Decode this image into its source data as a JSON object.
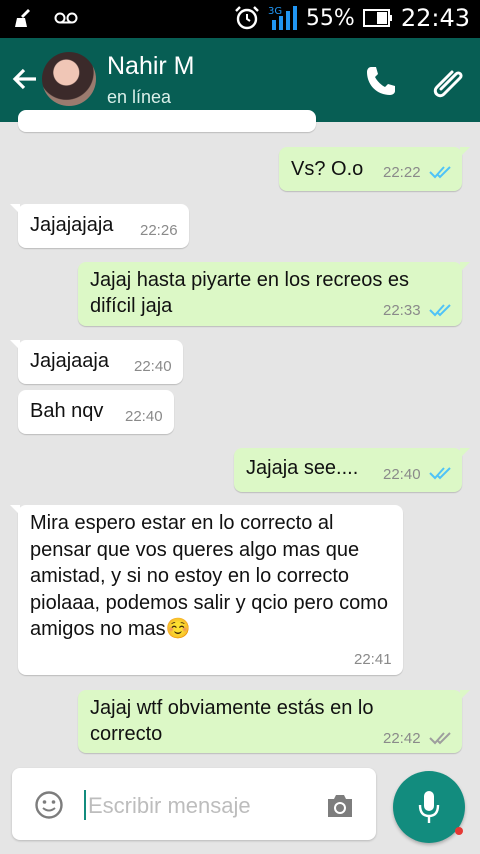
{
  "status_bar": {
    "battery": "55%",
    "time": "22:43",
    "network": "3G"
  },
  "header": {
    "contact_name": "Nahir M",
    "contact_status": "en línea",
    "icons": [
      "back-arrow-icon",
      "phone-icon",
      "paperclip-icon"
    ]
  },
  "messages": [
    {
      "dir": "out",
      "text": "Vs?  O.o",
      "time": "22:22",
      "status": "read"
    },
    {
      "dir": "in",
      "text": "Jajajajaja",
      "time": "22:26"
    },
    {
      "dir": "out",
      "text": "Jajaj hasta piyarte en los recreos es difícil jaja",
      "time": "22:33",
      "status": "read"
    },
    {
      "dir": "in",
      "text": "Jajajaaja",
      "time": "22:40"
    },
    {
      "dir": "in",
      "text": "Bah nqv",
      "time": "22:40"
    },
    {
      "dir": "out",
      "text": "Jajaja see....",
      "time": "22:40",
      "status": "read"
    },
    {
      "dir": "in",
      "text": "Mira espero estar en lo correcto al pensar que vos queres algo mas que amistad, y si no estoy en lo correcto piolaaa, podemos salir y qcio pero como amigos no mas☺️",
      "time": "22:41"
    },
    {
      "dir": "out",
      "text": "Jajaj wtf obviamente estás en lo correcto",
      "time": "22:42",
      "status": "delivered"
    }
  ],
  "composer": {
    "placeholder": "Escribir mensaje",
    "value": ""
  },
  "colors": {
    "app_bar": "#075e54",
    "accent": "#128c7e",
    "outgoing_bubble": "#dcf8c6",
    "incoming_bubble": "#ffffff",
    "read_tick": "#4fc3f7",
    "delivered_tick": "#9e9e9e"
  }
}
